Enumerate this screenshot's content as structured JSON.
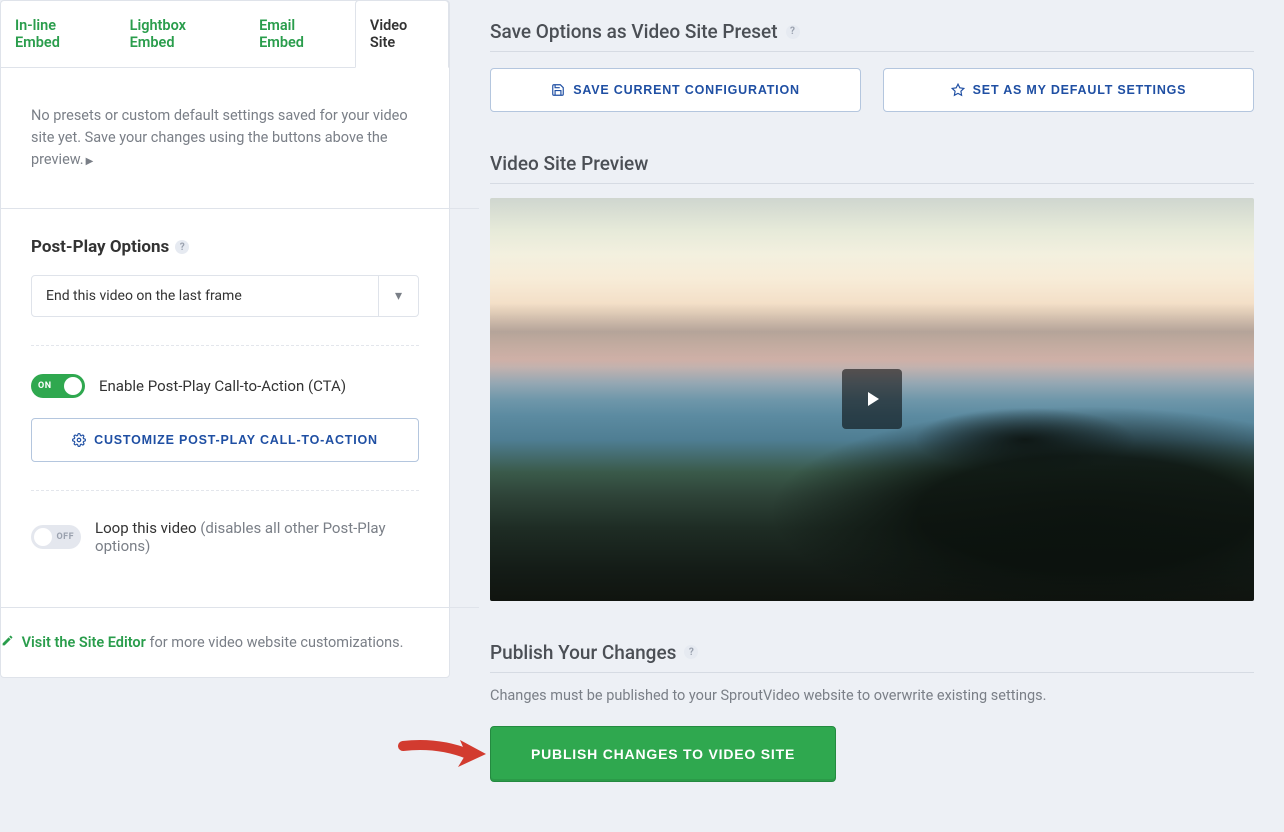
{
  "tabs": {
    "inline": "In-line Embed",
    "lightbox": "Lightbox Embed",
    "email": "Email Embed",
    "videosite": "Video Site"
  },
  "notice": "No presets or custom default settings saved for your video site yet. Save your changes using the buttons above the preview.",
  "postplay": {
    "title": "Post-Play Options",
    "select_value": "End this video on the last frame",
    "cta_toggle_label": "Enable Post-Play Call-to-Action (CTA)",
    "cta_toggle_text": "ON",
    "customize_btn": "CUSTOMIZE POST-PLAY CALL-TO-ACTION",
    "loop_label": "Loop this video",
    "loop_note": "(disables all other Post-Play options)",
    "loop_toggle_text": "OFF"
  },
  "site_editor": {
    "link": "Visit the Site Editor",
    "rest": " for more video website customizations."
  },
  "right": {
    "save_title": "Save Options as Video Site Preset",
    "save_btn": "SAVE CURRENT CONFIGURATION",
    "default_btn": "SET AS MY DEFAULT SETTINGS",
    "preview_title": "Video Site Preview",
    "publish_title": "Publish Your Changes",
    "publish_note": "Changes must be published to your SproutVideo website to overwrite existing settings.",
    "publish_btn": "PUBLISH CHANGES TO VIDEO SITE"
  }
}
